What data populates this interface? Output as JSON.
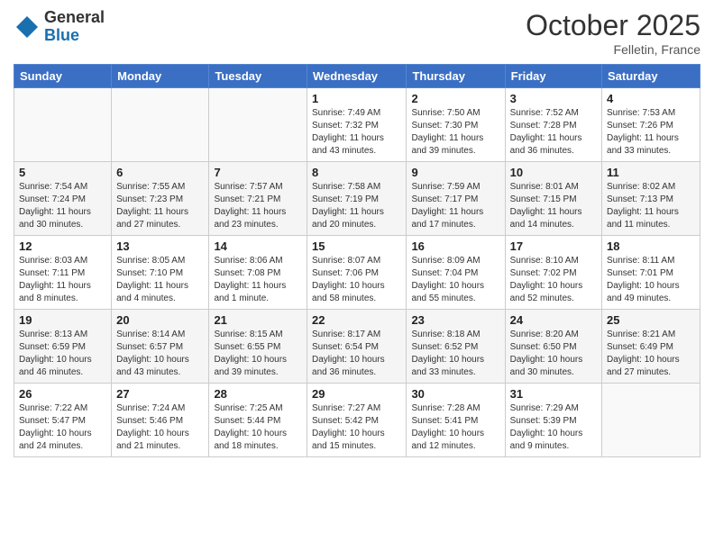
{
  "logo": {
    "general": "General",
    "blue": "Blue"
  },
  "header": {
    "month": "October 2025",
    "location": "Felletin, France"
  },
  "weekdays": [
    "Sunday",
    "Monday",
    "Tuesday",
    "Wednesday",
    "Thursday",
    "Friday",
    "Saturday"
  ],
  "weeks": [
    [
      {
        "day": "",
        "info": ""
      },
      {
        "day": "",
        "info": ""
      },
      {
        "day": "",
        "info": ""
      },
      {
        "day": "1",
        "info": "Sunrise: 7:49 AM\nSunset: 7:32 PM\nDaylight: 11 hours\nand 43 minutes."
      },
      {
        "day": "2",
        "info": "Sunrise: 7:50 AM\nSunset: 7:30 PM\nDaylight: 11 hours\nand 39 minutes."
      },
      {
        "day": "3",
        "info": "Sunrise: 7:52 AM\nSunset: 7:28 PM\nDaylight: 11 hours\nand 36 minutes."
      },
      {
        "day": "4",
        "info": "Sunrise: 7:53 AM\nSunset: 7:26 PM\nDaylight: 11 hours\nand 33 minutes."
      }
    ],
    [
      {
        "day": "5",
        "info": "Sunrise: 7:54 AM\nSunset: 7:24 PM\nDaylight: 11 hours\nand 30 minutes."
      },
      {
        "day": "6",
        "info": "Sunrise: 7:55 AM\nSunset: 7:23 PM\nDaylight: 11 hours\nand 27 minutes."
      },
      {
        "day": "7",
        "info": "Sunrise: 7:57 AM\nSunset: 7:21 PM\nDaylight: 11 hours\nand 23 minutes."
      },
      {
        "day": "8",
        "info": "Sunrise: 7:58 AM\nSunset: 7:19 PM\nDaylight: 11 hours\nand 20 minutes."
      },
      {
        "day": "9",
        "info": "Sunrise: 7:59 AM\nSunset: 7:17 PM\nDaylight: 11 hours\nand 17 minutes."
      },
      {
        "day": "10",
        "info": "Sunrise: 8:01 AM\nSunset: 7:15 PM\nDaylight: 11 hours\nand 14 minutes."
      },
      {
        "day": "11",
        "info": "Sunrise: 8:02 AM\nSunset: 7:13 PM\nDaylight: 11 hours\nand 11 minutes."
      }
    ],
    [
      {
        "day": "12",
        "info": "Sunrise: 8:03 AM\nSunset: 7:11 PM\nDaylight: 11 hours\nand 8 minutes."
      },
      {
        "day": "13",
        "info": "Sunrise: 8:05 AM\nSunset: 7:10 PM\nDaylight: 11 hours\nand 4 minutes."
      },
      {
        "day": "14",
        "info": "Sunrise: 8:06 AM\nSunset: 7:08 PM\nDaylight: 11 hours\nand 1 minute."
      },
      {
        "day": "15",
        "info": "Sunrise: 8:07 AM\nSunset: 7:06 PM\nDaylight: 10 hours\nand 58 minutes."
      },
      {
        "day": "16",
        "info": "Sunrise: 8:09 AM\nSunset: 7:04 PM\nDaylight: 10 hours\nand 55 minutes."
      },
      {
        "day": "17",
        "info": "Sunrise: 8:10 AM\nSunset: 7:02 PM\nDaylight: 10 hours\nand 52 minutes."
      },
      {
        "day": "18",
        "info": "Sunrise: 8:11 AM\nSunset: 7:01 PM\nDaylight: 10 hours\nand 49 minutes."
      }
    ],
    [
      {
        "day": "19",
        "info": "Sunrise: 8:13 AM\nSunset: 6:59 PM\nDaylight: 10 hours\nand 46 minutes."
      },
      {
        "day": "20",
        "info": "Sunrise: 8:14 AM\nSunset: 6:57 PM\nDaylight: 10 hours\nand 43 minutes."
      },
      {
        "day": "21",
        "info": "Sunrise: 8:15 AM\nSunset: 6:55 PM\nDaylight: 10 hours\nand 39 minutes."
      },
      {
        "day": "22",
        "info": "Sunrise: 8:17 AM\nSunset: 6:54 PM\nDaylight: 10 hours\nand 36 minutes."
      },
      {
        "day": "23",
        "info": "Sunrise: 8:18 AM\nSunset: 6:52 PM\nDaylight: 10 hours\nand 33 minutes."
      },
      {
        "day": "24",
        "info": "Sunrise: 8:20 AM\nSunset: 6:50 PM\nDaylight: 10 hours\nand 30 minutes."
      },
      {
        "day": "25",
        "info": "Sunrise: 8:21 AM\nSunset: 6:49 PM\nDaylight: 10 hours\nand 27 minutes."
      }
    ],
    [
      {
        "day": "26",
        "info": "Sunrise: 7:22 AM\nSunset: 5:47 PM\nDaylight: 10 hours\nand 24 minutes."
      },
      {
        "day": "27",
        "info": "Sunrise: 7:24 AM\nSunset: 5:46 PM\nDaylight: 10 hours\nand 21 minutes."
      },
      {
        "day": "28",
        "info": "Sunrise: 7:25 AM\nSunset: 5:44 PM\nDaylight: 10 hours\nand 18 minutes."
      },
      {
        "day": "29",
        "info": "Sunrise: 7:27 AM\nSunset: 5:42 PM\nDaylight: 10 hours\nand 15 minutes."
      },
      {
        "day": "30",
        "info": "Sunrise: 7:28 AM\nSunset: 5:41 PM\nDaylight: 10 hours\nand 12 minutes."
      },
      {
        "day": "31",
        "info": "Sunrise: 7:29 AM\nSunset: 5:39 PM\nDaylight: 10 hours\nand 9 minutes."
      },
      {
        "day": "",
        "info": ""
      }
    ]
  ]
}
